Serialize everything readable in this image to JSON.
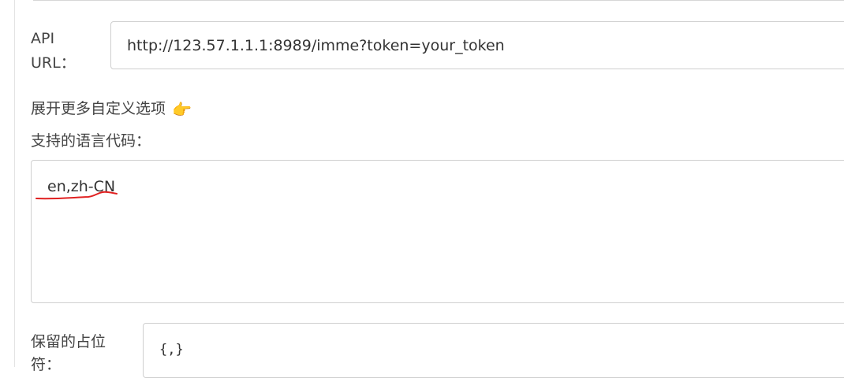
{
  "api": {
    "label": "API\nURL：",
    "value": "http://123.57.1.1.1:8989/imme?token=your_token"
  },
  "expand": {
    "label": "展开更多自定义选项",
    "icon": "pointing-hand-icon"
  },
  "languages": {
    "label": "支持的语言代码：",
    "value": "en,zh-CN",
    "annotation_color": "#e02020"
  },
  "placeholder": {
    "label": "保留的占位\n符：",
    "value": "{,}"
  }
}
